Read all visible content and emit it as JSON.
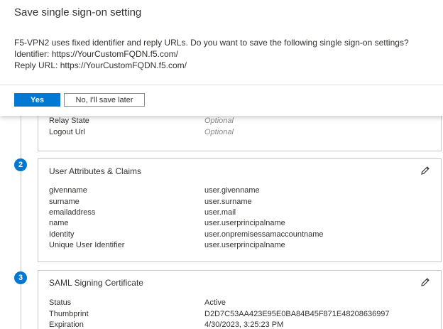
{
  "dialog": {
    "title": "Save single sign-on setting",
    "message": "F5-VPN2 uses fixed identifier and reply URLs. Do you want to save the following single sign-on settings?",
    "identifier_line": "Identifier: https://YourCustomFQDN.f5.com/",
    "reply_url_line": "Reply URL: https://YourCustomFQDN.f5.com/",
    "yes_label": "Yes",
    "later_label": "No, I'll save later"
  },
  "basic_config": {
    "rows": [
      {
        "label": "Relay State",
        "value": "Optional"
      },
      {
        "label": "Logout Url",
        "value": "Optional"
      }
    ]
  },
  "attributes": {
    "step": "2",
    "title": "User Attributes & Claims",
    "edit_icon": "pencil-icon",
    "rows": [
      {
        "label": "givenname",
        "value": "user.givenname"
      },
      {
        "label": "surname",
        "value": "user.surname"
      },
      {
        "label": "emailaddress",
        "value": "user.mail"
      },
      {
        "label": "name",
        "value": "user.userprincipalname"
      },
      {
        "label": "Identity",
        "value": "user.onpremisessamaccountname"
      },
      {
        "label": "Unique User Identifier",
        "value": "user.userprincipalname"
      }
    ]
  },
  "certificate": {
    "step": "3",
    "title": "SAML Signing Certificate",
    "edit_icon": "pencil-icon",
    "rows": [
      {
        "label": "Status",
        "value": "Active"
      },
      {
        "label": "Thumbprint",
        "value": "D2D7C53AA423E95E0BA84B45F871E48208636997"
      },
      {
        "label": "Expiration",
        "value": "4/30/2023, 3:25:23 PM"
      }
    ]
  },
  "colors": {
    "accent": "#0078d4",
    "border": "#c8c6c4",
    "muted": "#8a8886"
  }
}
